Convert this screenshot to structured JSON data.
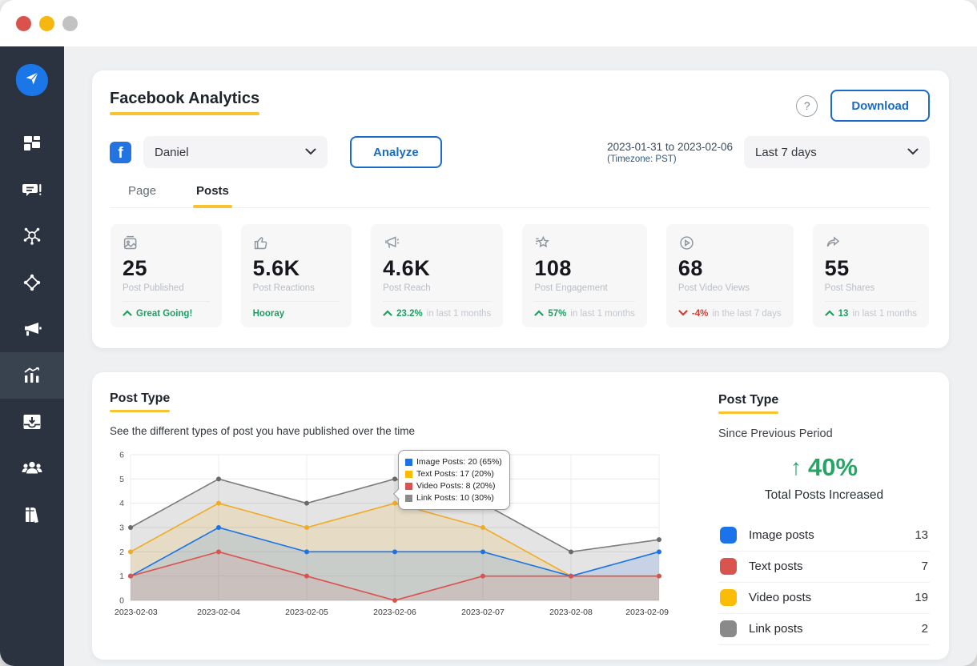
{
  "window": {
    "traffic_lights": [
      "close",
      "minimize",
      "maximize"
    ]
  },
  "sidebar": {
    "items": [
      {
        "name": "logo-send",
        "active": false
      },
      {
        "name": "dashboard",
        "active": false
      },
      {
        "name": "posts-composer",
        "active": false
      },
      {
        "name": "network",
        "active": false
      },
      {
        "name": "automation",
        "active": false
      },
      {
        "name": "announcements",
        "active": false
      },
      {
        "name": "analytics",
        "active": true
      },
      {
        "name": "inbox",
        "active": false
      },
      {
        "name": "team",
        "active": false
      },
      {
        "name": "library",
        "active": false
      }
    ]
  },
  "header": {
    "title": "Facebook Analytics",
    "account": "Daniel",
    "analyze_label": "Analyze",
    "help_label": "?",
    "download_label": "Download",
    "date_range": "2023-01-31 to 2023-02-06",
    "timezone": "(Timezone: PST)",
    "period_label": "Last 7 days"
  },
  "tabs": [
    {
      "label": "Page",
      "active": false
    },
    {
      "label": "Posts",
      "active": true
    }
  ],
  "cards": [
    {
      "icon": "image-icon",
      "value": "25",
      "label": "Post Published",
      "trend": "up",
      "highlight": "Great Going!",
      "suffix": ""
    },
    {
      "icon": "thumbs-up-icon",
      "value": "5.6K",
      "label": "Post Reactions",
      "trend": "none",
      "highlight": "Hooray",
      "suffix": ""
    },
    {
      "icon": "megaphone-icon",
      "value": "4.6K",
      "label": "Post Reach",
      "trend": "up",
      "highlight": "23.2%",
      "suffix": "in last 1 months"
    },
    {
      "icon": "star-icon",
      "value": "108",
      "label": "Post Engagement",
      "trend": "up",
      "highlight": "57%",
      "suffix": "in last 1 months"
    },
    {
      "icon": "play-circle-icon",
      "value": "68",
      "label": "Post Video Views",
      "trend": "down",
      "highlight": "-4%",
      "suffix": "in the last 7 days"
    },
    {
      "icon": "share-icon",
      "value": "55",
      "label": "Post Shares",
      "trend": "up",
      "highlight": "13",
      "suffix": "in last 1 months"
    }
  ],
  "chart_section": {
    "title": "Post Type",
    "subtitle": "See the different types of post you have published over the time"
  },
  "chart_data": {
    "type": "area",
    "x": [
      "2023-02-03",
      "2023-02-04",
      "2023-02-05",
      "2023-02-06",
      "2023-02-07",
      "2023-02-08",
      "2023-02-09"
    ],
    "series": [
      {
        "name": "Image Posts",
        "color": "#1a73e8",
        "fill": "rgba(26,115,232,0.14)",
        "values": [
          1,
          3,
          2,
          2,
          2,
          1,
          2
        ]
      },
      {
        "name": "Text Posts",
        "color": "#f0ab26",
        "fill": "rgba(245,180,35,0.16)",
        "values": [
          2,
          4,
          3,
          4,
          3,
          1,
          1
        ]
      },
      {
        "name": "Video Posts",
        "color": "#d9534f",
        "fill": "rgba(217,83,79,0.10)",
        "values": [
          1,
          2,
          1,
          0,
          1,
          1,
          1
        ]
      },
      {
        "name": "Link Posts",
        "color": "#7c7c7c",
        "fill": "rgba(130,130,130,0.22)",
        "values": [
          3,
          5,
          4,
          5,
          4,
          2,
          2.5
        ]
      }
    ],
    "ylim": [
      0,
      6
    ],
    "yticks": [
      0,
      1,
      2,
      3,
      4,
      5,
      6
    ],
    "grid": true,
    "legend_position": "tooltip",
    "tooltip": {
      "items": [
        {
          "label": "Image Posts: 20 (65%)",
          "color": "#1a73e8"
        },
        {
          "label": "Text Posts: 17 (20%)",
          "color": "#fbbc05"
        },
        {
          "label": "Video Posts: 8 (20%)",
          "color": "#d9534f"
        },
        {
          "label": "Link Posts: 10 (30%)",
          "color": "#8a8a8a"
        }
      ]
    }
  },
  "summary": {
    "title": "Post Type",
    "subtitle": "Since Previous Period",
    "delta_arrow": "↑",
    "delta": "40%",
    "delta_note": "Total Posts Increased",
    "legend": [
      {
        "label": "Image posts",
        "value": "13",
        "color": "#1a73e8"
      },
      {
        "label": "Text posts",
        "value": "7",
        "color": "#d9534f"
      },
      {
        "label": "Video posts",
        "value": "19",
        "color": "#fbbc05"
      },
      {
        "label": "Link posts",
        "value": "2",
        "color": "#8a8a8a"
      }
    ]
  }
}
